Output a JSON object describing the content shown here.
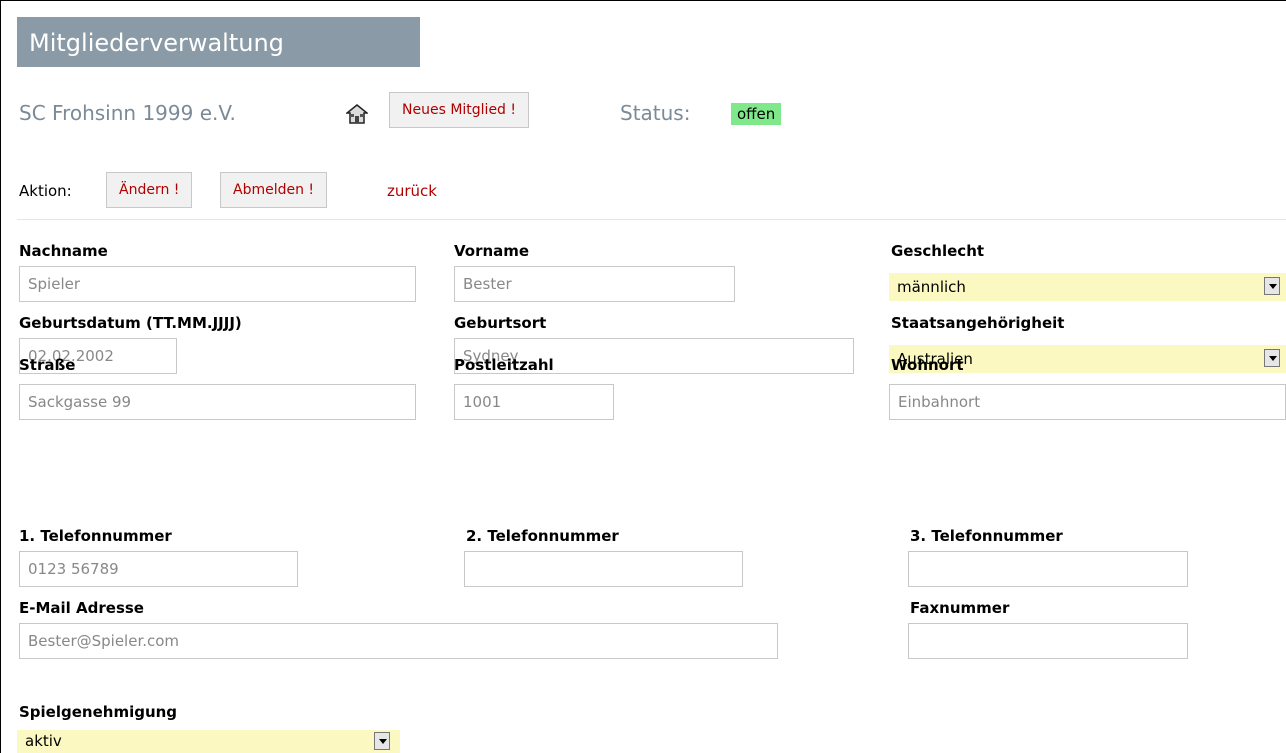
{
  "header": {
    "title": "Mitgliederverwaltung"
  },
  "club": {
    "name": "SC Frohsinn 1999 e.V.",
    "home_icon": "house-icon"
  },
  "toolbar": {
    "new_member_label": "Neues Mitglied !",
    "status_label": "Status:",
    "status_value": "offen",
    "status_color": "#7fe88a"
  },
  "actions": {
    "label": "Aktion:",
    "edit_label": "Ändern !",
    "deregister_label": "Abmelden !",
    "back_label": "zurück"
  },
  "form": {
    "nachname": {
      "label": "Nachname",
      "value": "Spieler"
    },
    "vorname": {
      "label": "Vorname",
      "value": "Bester"
    },
    "geschlecht": {
      "label": "Geschlecht",
      "value": "männlich"
    },
    "geburtsdatum": {
      "label": "Geburtsdatum (TT.MM.JJJJ)",
      "value": "02.02.2002"
    },
    "geburtsort": {
      "label": "Geburtsort",
      "value": "Sydney"
    },
    "staatsangehoerigkeit": {
      "label": "Staatsangehörigheit",
      "value": "Australien"
    },
    "strasse": {
      "label": "Straße",
      "value": "Sackgasse 99"
    },
    "plz": {
      "label": "Postleitzahl",
      "value": "1001"
    },
    "wohnort": {
      "label": "Wohnort",
      "value": "Einbahnort"
    },
    "telefon1": {
      "label": "1. Telefonnummer",
      "value": "0123 56789"
    },
    "telefon2": {
      "label": "2. Telefonnummer",
      "value": ""
    },
    "telefon3": {
      "label": "3. Telefonnummer",
      "value": ""
    },
    "email": {
      "label": "E-Mail Adresse",
      "value": "Bester@Spieler.com"
    },
    "fax": {
      "label": "Faxnummer",
      "value": ""
    },
    "spielgenehmigung": {
      "label": "Spielgenehmigung",
      "value": "aktiv"
    }
  },
  "colors": {
    "accent": "#b00000",
    "select_bg": "#fcf8c2",
    "header_bg": "#8a9aa6"
  }
}
